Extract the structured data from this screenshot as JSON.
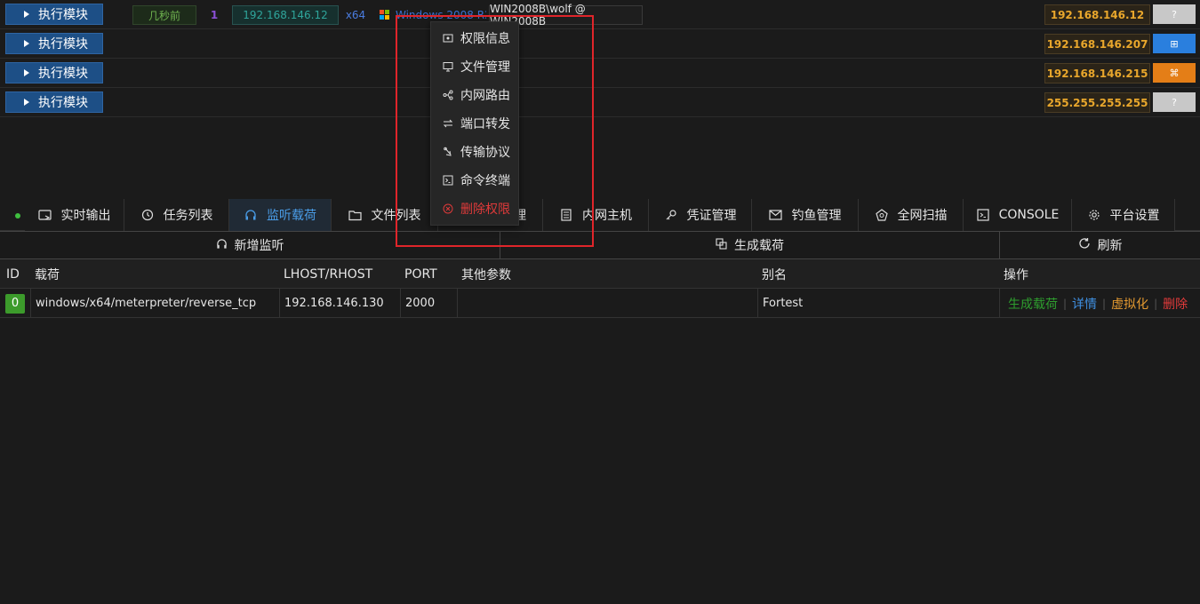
{
  "sessions": [
    {
      "exec_label": "执行模块",
      "time": "几秒前",
      "count": "1",
      "internal_ip": "192.168.146.12",
      "arch": "x64",
      "os_text": "Windows 2008 R2",
      "user": "WIN2008B\\wolf @ WIN2008B",
      "ip": "192.168.146.12",
      "os_badge": "?"
    },
    {
      "exec_label": "执行模块",
      "ip": "192.168.146.207",
      "os_badge": "⊞"
    },
    {
      "exec_label": "执行模块",
      "ip": "192.168.146.215",
      "os_badge": "⌘"
    },
    {
      "exec_label": "执行模块",
      "ip": "255.255.255.255",
      "os_badge": "?"
    }
  ],
  "context_menu": [
    {
      "label": "权限信息",
      "icon": "key-icon"
    },
    {
      "label": "文件管理",
      "icon": "monitor-icon"
    },
    {
      "label": "内网路由",
      "icon": "route-icon"
    },
    {
      "label": "端口转发",
      "icon": "swap-icon"
    },
    {
      "label": "传输协议",
      "icon": "protocol-icon"
    },
    {
      "label": "命令终端",
      "icon": "terminal-icon"
    },
    {
      "label": "删除权限",
      "icon": "delete-icon"
    }
  ],
  "tabs": [
    {
      "label": "实时输出",
      "icon": "output-icon"
    },
    {
      "label": "任务列表",
      "icon": "clock-icon"
    },
    {
      "label": "监听载荷",
      "icon": "headphones-icon"
    },
    {
      "label": "文件列表",
      "icon": "folder-icon"
    },
    {
      "label": "理",
      "icon": ""
    },
    {
      "label": "内网主机",
      "icon": "host-icon"
    },
    {
      "label": "凭证管理",
      "icon": "key-icon"
    },
    {
      "label": "钓鱼管理",
      "icon": "mail-icon"
    },
    {
      "label": "全网扫描",
      "icon": "scan-icon"
    },
    {
      "label": "CONSOLE",
      "icon": "console-icon"
    },
    {
      "label": "平台设置",
      "icon": "gear-icon"
    }
  ],
  "actions": {
    "add_listener": "新增监听",
    "generate_payload": "生成载荷",
    "refresh": "刷新"
  },
  "table": {
    "headers": {
      "id": "ID",
      "payload": "载荷",
      "lhost": "LHOST/RHOST",
      "port": "PORT",
      "other": "其他参数",
      "alias": "别名",
      "ops": "操作"
    },
    "rows": [
      {
        "id": "0",
        "payload": "windows/x64/meterpreter/reverse_tcp",
        "lhost": "192.168.146.130",
        "port": "2000",
        "other": "",
        "alias": "Fortest",
        "ops": {
          "generate": "生成载荷",
          "detail": "详情",
          "virtualize": "虚拟化",
          "delete": "删除"
        }
      }
    ]
  },
  "colors": {
    "accent_blue": "#4a9de8",
    "ip_orange": "#e9a72c",
    "danger_red": "#e03a3a",
    "success_green": "#3c9b2b"
  }
}
